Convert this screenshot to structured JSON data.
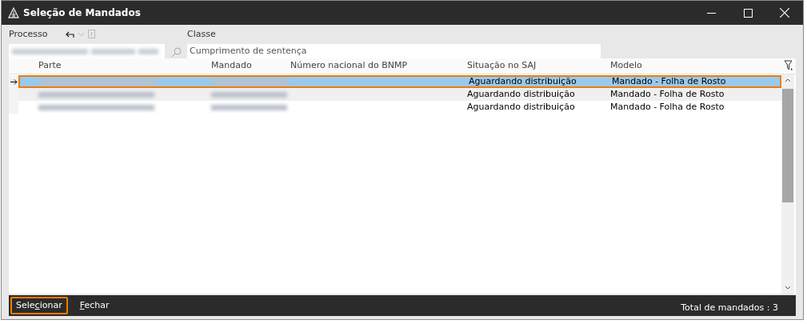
{
  "window": {
    "title": "Seleção de Mandados"
  },
  "filters": {
    "processo": {
      "label": "Processo"
    },
    "classe": {
      "label": "Classe",
      "value": "Cumprimento de sentença"
    }
  },
  "table": {
    "columns": [
      "Parte",
      "Mandado",
      "Número nacional do BNMP",
      "Situação no SAJ",
      "Modelo"
    ],
    "rows": [
      {
        "selected": true,
        "current": true,
        "situacao": "Aguardando distribuição",
        "modelo": "Mandado - Folha de Rosto"
      },
      {
        "selected": false,
        "current": false,
        "situacao": "Aguardando distribuição",
        "modelo": "Mandado - Folha de Rosto"
      },
      {
        "selected": false,
        "current": false,
        "situacao": "Aguardando distribuição",
        "modelo": "Mandado - Folha de Rosto"
      }
    ]
  },
  "buttons": [
    {
      "label_before_key": "Sele",
      "access_key": "c",
      "label_after_key": "ionar",
      "focused": true
    },
    {
      "access_key": "F",
      "label_after_key": "echar",
      "focused": false
    }
  ],
  "status": "Total de mandados : 3"
}
